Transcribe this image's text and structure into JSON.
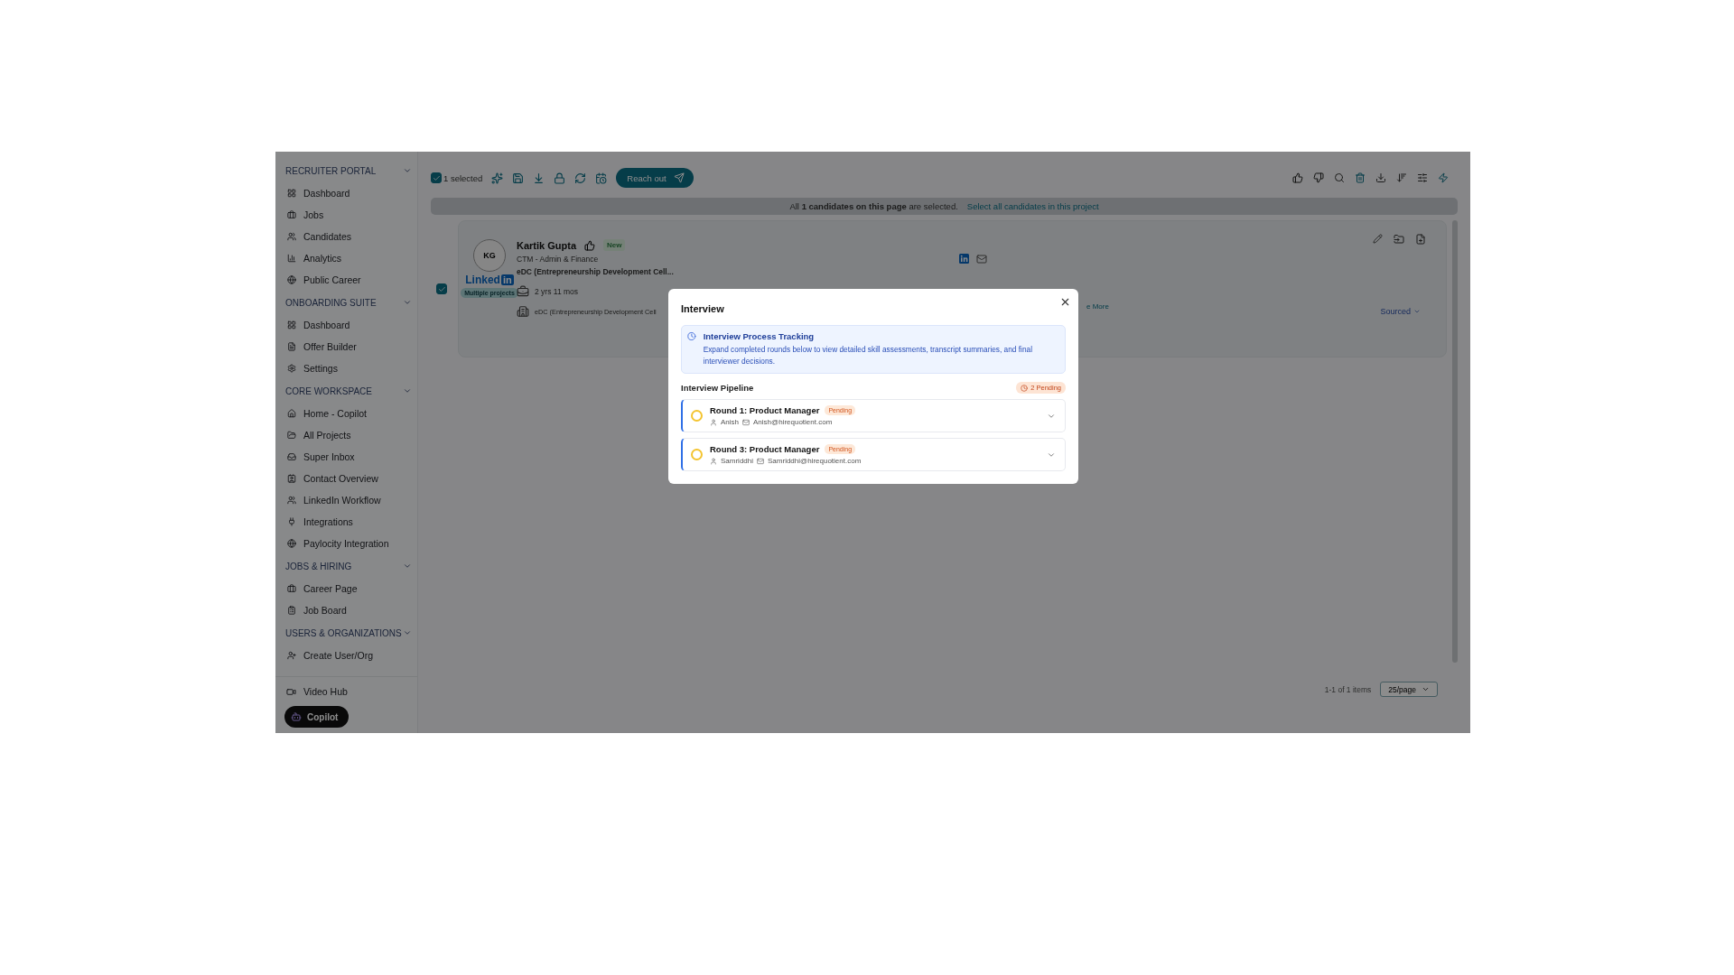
{
  "sidebar": {
    "sections": [
      {
        "title": "RECRUITER PORTAL",
        "expanded": true,
        "items": [
          "Dashboard",
          "Jobs",
          "Candidates",
          "Analytics",
          "Public Career"
        ]
      },
      {
        "title": "ONBOARDING SUITE",
        "expanded": true,
        "items": [
          "Dashboard",
          "Offer Builder",
          "Settings"
        ]
      },
      {
        "title": "CORE WORKSPACE",
        "expanded": true,
        "items": [
          "Home - Copilot",
          "All Projects",
          "Super Inbox",
          "Contact Overview",
          "LinkedIn Workflow",
          "Integrations",
          "Paylocity Integration"
        ]
      },
      {
        "title": "JOBS & HIRING",
        "expanded": true,
        "items": [
          "Career Page",
          "Job Board"
        ]
      },
      {
        "title": "USERS & ORGANIZATIONS",
        "expanded": true,
        "items": [
          "Create User/Org"
        ]
      }
    ],
    "footer_item": "Video Hub",
    "copilot_button": "Copilot"
  },
  "toolbar": {
    "select_all": {
      "checked": true,
      "label": "1 selected"
    },
    "reach_out_button": "Reach out"
  },
  "selection_banner": {
    "message": "All **1 candidates on this page** are selected.",
    "link": "Select all candidates in this project"
  },
  "candidate": {
    "checked": true,
    "initials": "KG",
    "linkedin_logo": [
      "Linked",
      "in"
    ],
    "projects_badge": "Multiple projects",
    "name": "Kartik Gupta",
    "badge": "New",
    "title": "CTM - Admin & Finance",
    "company": "eDC (Entrepreneurship Development Cell...",
    "experience": "2 yrs 11 mos",
    "organization": "eDC (Entrepreneurship Development Cell",
    "see_more": "e More",
    "stage": "Sourced"
  },
  "pagination": {
    "summary": "1-1 of 1 items",
    "page_size": "25/page"
  },
  "dialog": {
    "title": "Interview",
    "info": {
      "title": "Interview Process Tracking",
      "text": "Expand completed rounds below to view detailed skill assessments, transcript summaries, and final interviewer decisions."
    },
    "pipeline_title": "Interview Pipeline",
    "pending_count": "2 Pending",
    "rounds": [
      {
        "title": "Round 1: Product Manager",
        "status": "Pending",
        "interviewer": "Anish",
        "email": "Anish@hirequotient.com",
        "expanded": false
      },
      {
        "title": "Round 3: Product Manager",
        "status": "Pending",
        "interviewer": "Samriddhi",
        "email": "Samriddhi@hirequotient.com",
        "expanded": false
      }
    ]
  }
}
